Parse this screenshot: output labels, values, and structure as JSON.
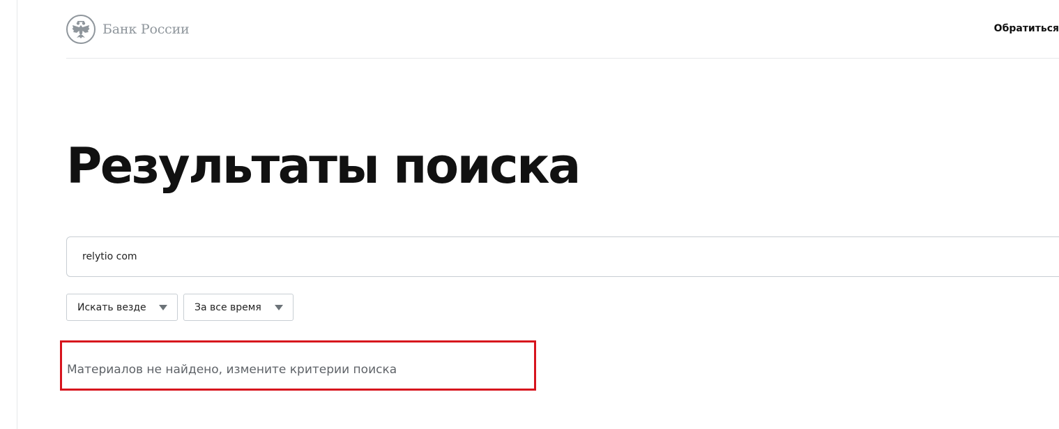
{
  "header": {
    "logo_text": "Банк России",
    "logo_icon": "double-headed-eagle-emblem",
    "action_label": "Обратиться"
  },
  "page": {
    "title": "Результаты поиска"
  },
  "search": {
    "value": "relytio com"
  },
  "filters": {
    "scope_label": "Искать везде",
    "period_label": "За все время"
  },
  "results": {
    "empty_message": "Материалов не найдено, измените критерии поиска"
  },
  "colors": {
    "highlight": "#d7141d",
    "logo_gray": "#8f969c",
    "border": "#c8ced3"
  }
}
